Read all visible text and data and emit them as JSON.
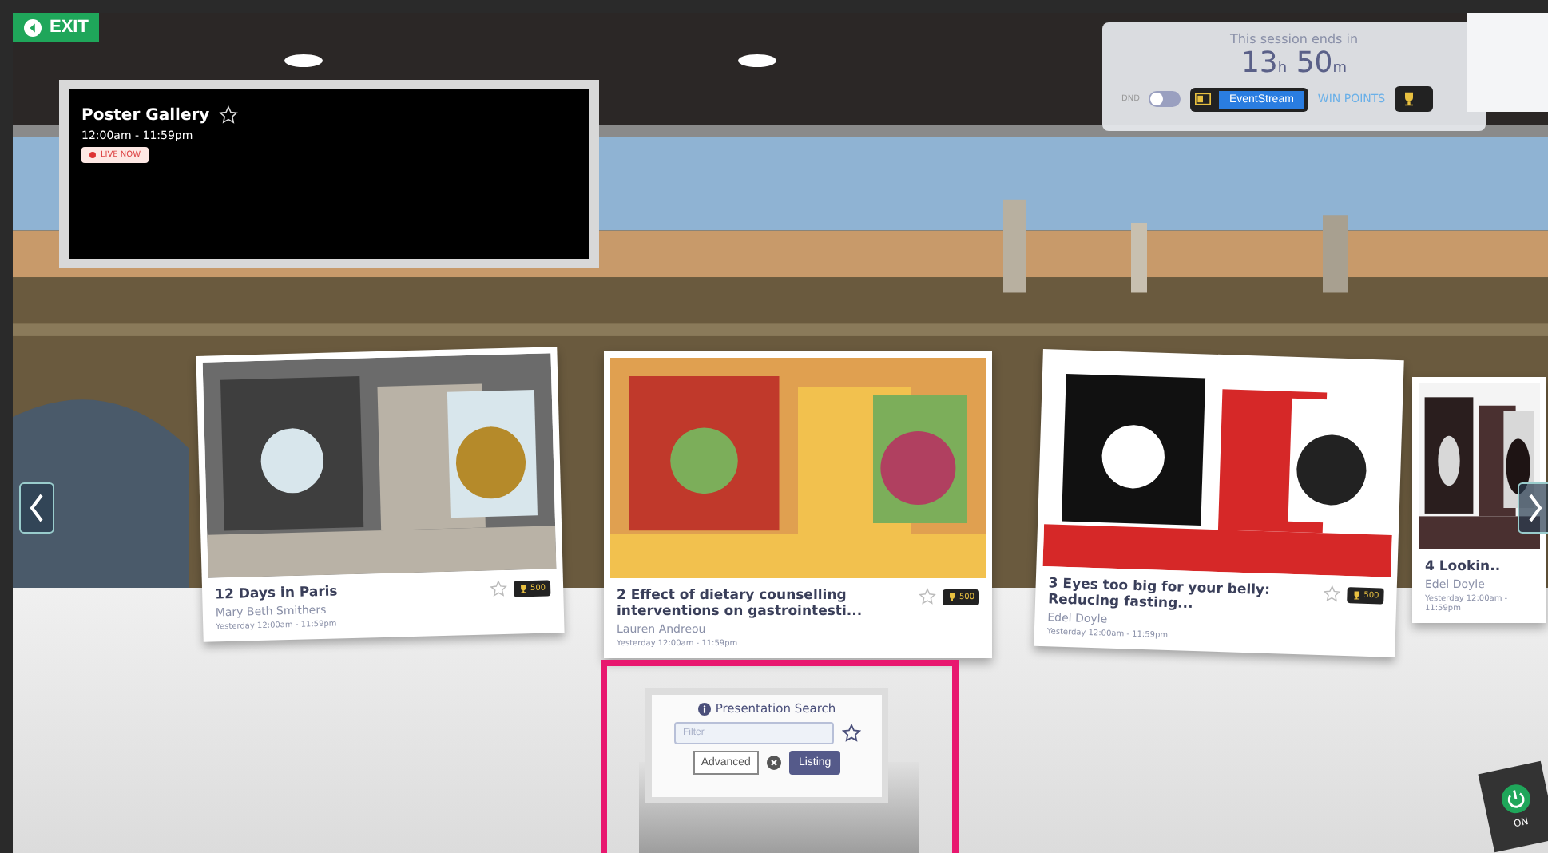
{
  "exit_button": {
    "label": "EXIT"
  },
  "screen": {
    "title": "Poster Gallery",
    "favorite": false,
    "time": "12:00am - 11:59pm",
    "badge": "LIVE NOW"
  },
  "session": {
    "caption": "This session ends in",
    "hours": "13",
    "hours_unit": "h",
    "minutes": "50",
    "minutes_unit": "m",
    "dnd": {
      "label": "DND",
      "on": false
    },
    "stream_button": "EventStream",
    "points_link": "WIN POINTS"
  },
  "posters": [
    {
      "title": "12 Days in Paris",
      "author": "Mary Beth Smithers",
      "time": "Yesterday 12:00am - 11:59pm",
      "points": "500",
      "favorite": false
    },
    {
      "title": "2 Effect of dietary counselling interventions on gastrointesti...",
      "author": "Lauren Andreou",
      "time": "Yesterday 12:00am - 11:59pm",
      "points": "500",
      "favorite": false
    },
    {
      "title": "3 Eyes too big for your belly: Reducing fasting...",
      "author": "Edel Doyle",
      "time": "Yesterday 12:00am - 11:59pm",
      "points": "500",
      "favorite": false
    },
    {
      "title": "4 Lookin..",
      "author": "Edel Doyle",
      "time": "Yesterday 12:00am - 11:59pm"
    }
  ],
  "search": {
    "title": "Presentation Search",
    "placeholder": "Filter",
    "favorite": false,
    "advanced": "Advanced",
    "listing": "Listing"
  },
  "power": {
    "label": "ON",
    "on": true
  }
}
